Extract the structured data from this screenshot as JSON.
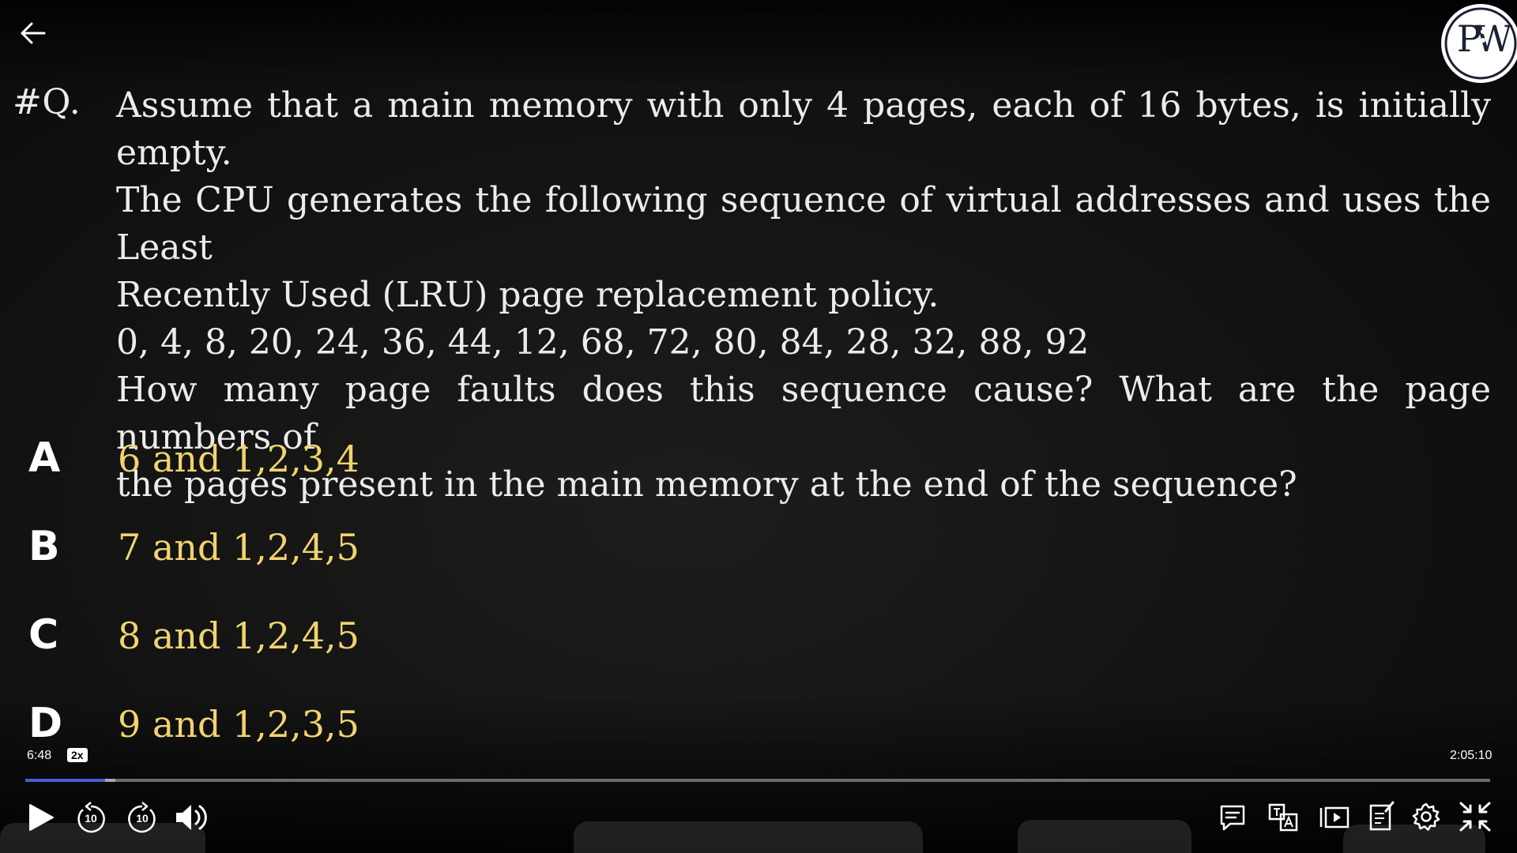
{
  "question": {
    "number": "#Q.",
    "lines": [
      "Assume that a main memory with only 4 pages, each of 16 bytes, is initially empty.",
      "The CPU generates the following sequence of virtual addresses and uses the Least",
      "Recently Used (LRU) page replacement policy.",
      "0, 4, 8, 20, 24, 36, 44, 12, 68, 72, 80, 84, 28, 32, 88, 92",
      "How many page faults does this sequence cause? What are the page numbers of",
      "the pages present in the main memory at the end of the sequence?"
    ]
  },
  "options": [
    {
      "letter": "A",
      "text": "6 and 1,2,3,4"
    },
    {
      "letter": "B",
      "text": "7 and 1,2,4,5"
    },
    {
      "letter": "C",
      "text": "8 and 1,2,4,5"
    },
    {
      "letter": "D",
      "text": "9 and 1,2,3,5"
    }
  ],
  "player": {
    "current_time": "6:48",
    "speed": "2x",
    "total_time": "2:05:10",
    "skip_back_label": "10",
    "skip_forward_label": "10",
    "progress_fraction": 0.0543,
    "buffered_fraction": 0.0615
  },
  "logo": {
    "letters": "PW"
  },
  "colors": {
    "question_text": "#ececec",
    "option_text": "#f1d36f",
    "progress_played": "#4a5bd8"
  }
}
